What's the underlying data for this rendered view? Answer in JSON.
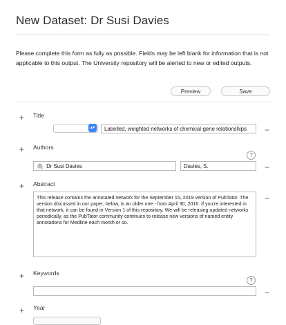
{
  "page": {
    "title": "New Dataset: Dr Susi Davies",
    "intro": "Please complete this form as fully as possible. Fields may be left blank for information that is not applicable to this output. The University repository will be alerted to new or edited outputs."
  },
  "toolbar": {
    "preview_label": "Preview",
    "save_label": "Save"
  },
  "icons": {
    "plus": "+",
    "minus": "−",
    "help": "?",
    "chevron": "▴▾",
    "clip": "🖇"
  },
  "fields": {
    "title": {
      "label": "Title",
      "select_value": "",
      "value": "Labelled, weighted networks of chemical-gene relationships"
    },
    "authors": {
      "label": "Authors",
      "name": "Dr Susi Davies",
      "short_name": "Davies, S."
    },
    "abstract": {
      "label": "Abstract",
      "value": "This release contains the annotated network for the September 15, 2019 version of PubTator. The version discussed in our paper, below, is an older one - from April 30, 2016. If you're interested in that network, it can be found in Version 1 of this repository. We will be releasing updated networks periodically, as the PubTator community continues to release new versions of named entity annotations for Medline each month or so."
    },
    "keywords": {
      "label": "Keywords",
      "value": ""
    },
    "year": {
      "label": "Year"
    }
  }
}
